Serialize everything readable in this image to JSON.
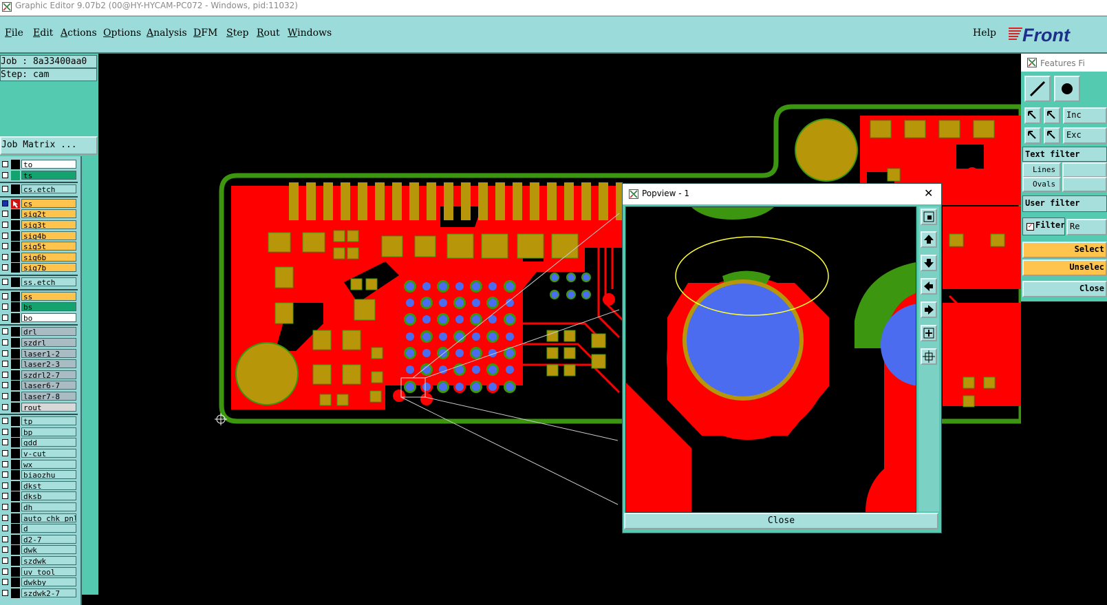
{
  "window": {
    "title": "Graphic Editor 9.07b2 (00@HY-HYCAM-PC072 - Windows, pid:11032)"
  },
  "menu": {
    "items": [
      {
        "label": "File",
        "key": "F",
        "rest": "ile"
      },
      {
        "label": "Edit",
        "key": "E",
        "rest": "dit"
      },
      {
        "label": "Actions",
        "key": "A",
        "rest": "ctions"
      },
      {
        "label": "Options",
        "key": "O",
        "rest": "ptions"
      },
      {
        "label": "Analysis",
        "key": "A",
        "rest": "nalysis"
      },
      {
        "label": "DFM",
        "key": "D",
        "rest": "FM"
      },
      {
        "label": "Step",
        "key": "S",
        "rest": "tep"
      },
      {
        "label": "Rout",
        "key": "R",
        "rest": "out"
      },
      {
        "label": "Windows",
        "key": "W",
        "rest": "indows"
      }
    ],
    "help": "Help",
    "logo": "Front"
  },
  "job": {
    "job_label": "Job : 8a33400aa0",
    "step_label": "Step: cam",
    "matrix_button": "Job Matrix ..."
  },
  "layers": [
    {
      "name": "to",
      "color": "#ffffff"
    },
    {
      "name": "ts",
      "color": "#14a36f",
      "ind": "#14a36f"
    },
    {
      "sep": true
    },
    {
      "name": "cs.etch",
      "color": "#a7dfdd"
    },
    {
      "sep": true
    },
    {
      "name": "cs",
      "color": "#ffc44d",
      "active": true
    },
    {
      "name": "sig2t",
      "color": "#ffc44d"
    },
    {
      "name": "sig3t",
      "color": "#ffc44d"
    },
    {
      "name": "sig4b",
      "color": "#ffc44d"
    },
    {
      "name": "sig5t",
      "color": "#ffc44d"
    },
    {
      "name": "sig6b",
      "color": "#ffc44d"
    },
    {
      "name": "sig7b",
      "color": "#ffc44d"
    },
    {
      "sep": true
    },
    {
      "name": "ss.etch",
      "color": "#a7dfdd"
    },
    {
      "sep": true
    },
    {
      "name": "ss",
      "color": "#ffc44d"
    },
    {
      "name": "bs",
      "color": "#14a36f"
    },
    {
      "name": "bo",
      "color": "#ffffff"
    },
    {
      "sep": true
    },
    {
      "name": "drl",
      "color": "#a9bcc4"
    },
    {
      "name": "szdrl",
      "color": "#a9bcc4"
    },
    {
      "name": "laser1-2",
      "color": "#a9bcc4"
    },
    {
      "name": "laser2-3",
      "color": "#a9bcc4"
    },
    {
      "name": "szdrl2-7",
      "color": "#a9bcc4"
    },
    {
      "name": "laser6-7",
      "color": "#a9bcc4"
    },
    {
      "name": "laser7-8",
      "color": "#a9bcc4"
    },
    {
      "name": "rout",
      "color": "#d8d8d8"
    },
    {
      "sep": true
    },
    {
      "name": "tp",
      "color": "#a7dfdd"
    },
    {
      "name": "bp",
      "color": "#a7dfdd"
    },
    {
      "name": "gdd",
      "color": "#a7dfdd"
    },
    {
      "name": "v-cut",
      "color": "#a7dfdd"
    },
    {
      "name": "wx",
      "color": "#a7dfdd"
    },
    {
      "name": "biaozhu",
      "color": "#a7dfdd"
    },
    {
      "name": "dkst",
      "color": "#a7dfdd"
    },
    {
      "name": "dksb",
      "color": "#a7dfdd"
    },
    {
      "name": "dh",
      "color": "#a7dfdd"
    },
    {
      "name": "auto_chk_pnl",
      "color": "#a7dfdd"
    },
    {
      "name": "d",
      "color": "#a7dfdd"
    },
    {
      "name": "d2-7",
      "color": "#a7dfdd"
    },
    {
      "name": "dwk",
      "color": "#a7dfdd"
    },
    {
      "name": "szdwk",
      "color": "#a7dfdd"
    },
    {
      "name": "uv_tool",
      "color": "#a7dfdd"
    },
    {
      "name": "dwkby",
      "color": "#a7dfdd"
    },
    {
      "name": "szdwk2-7",
      "color": "#a7dfdd"
    }
  ],
  "popview": {
    "title": "Popview - 1",
    "close_label": "Close",
    "close_x": "✕"
  },
  "features_filter": {
    "title": "Features Fi",
    "include": "Inc",
    "exclude": "Exc",
    "text_filter": "Text filter",
    "lines": "Lines",
    "ovals": "Ovals",
    "user_filter": "User filter",
    "filter": "Filter",
    "reset": "Re",
    "select": "Select",
    "unselect": "Unselec",
    "close": "Close"
  },
  "colors": {
    "copper": "#ff0000",
    "pad": "#b8960a",
    "via": "#4c6cf0",
    "outline": "#3d9610",
    "highlight": "#ffff33"
  }
}
